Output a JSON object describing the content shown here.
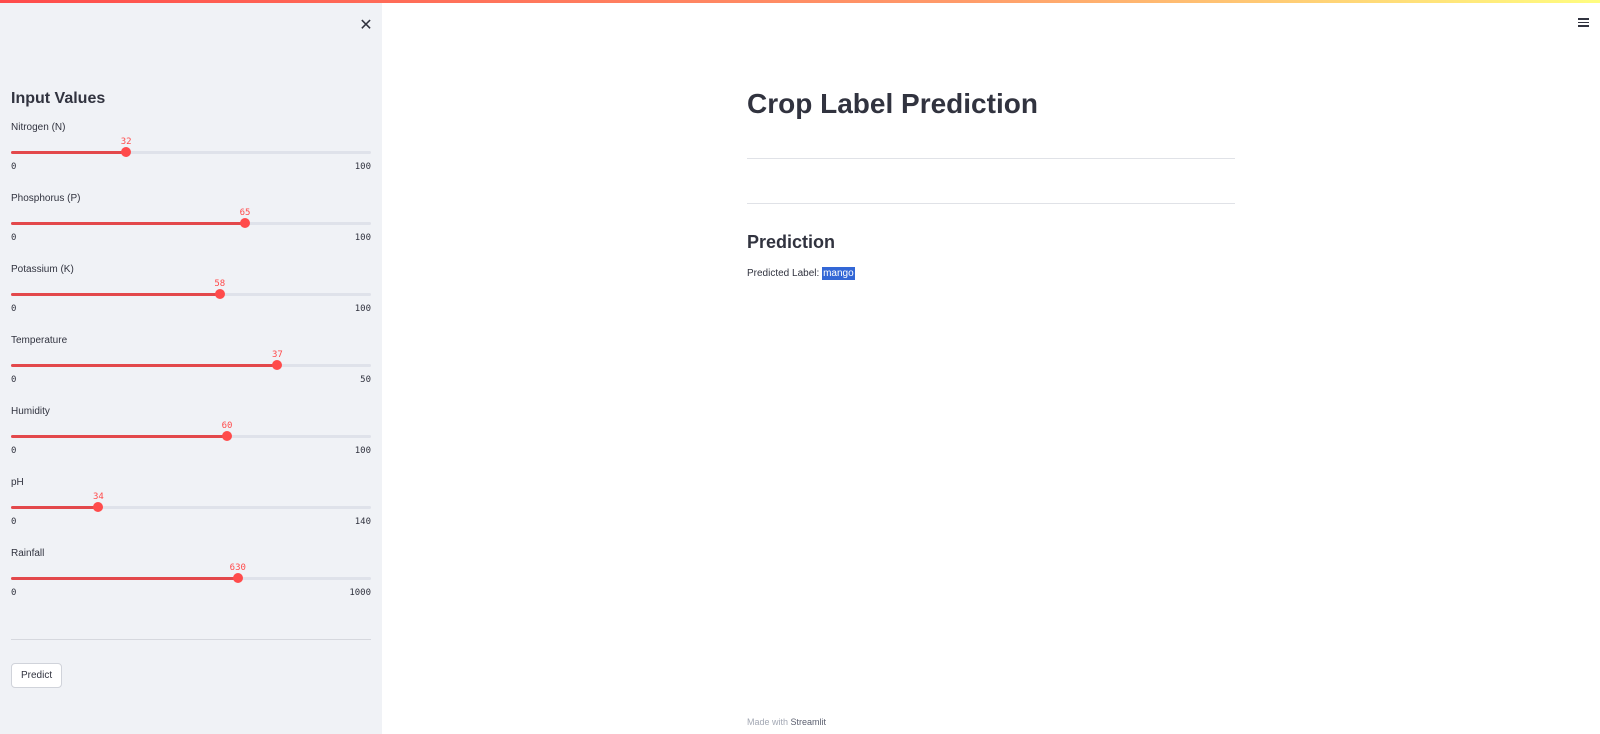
{
  "sidebar": {
    "close_icon": "close-icon",
    "title": "Input Values",
    "sliders": [
      {
        "label": "Nitrogen (N)",
        "value": "32",
        "min": "0",
        "max": "100"
      },
      {
        "label": "Phosphorus (P)",
        "value": "65",
        "min": "0",
        "max": "100"
      },
      {
        "label": "Potassium (K)",
        "value": "58",
        "min": "0",
        "max": "100"
      },
      {
        "label": "Temperature",
        "value": "37",
        "min": "0",
        "max": "50"
      },
      {
        "label": "Humidity",
        "value": "60",
        "min": "0",
        "max": "100"
      },
      {
        "label": "pH",
        "value": "34",
        "min": "0",
        "max": "140"
      },
      {
        "label": "Rainfall",
        "value": "630",
        "min": "0",
        "max": "1000"
      }
    ],
    "predict_label": "Predict"
  },
  "header": {
    "menu_icon": "hamburger-menu-icon"
  },
  "main": {
    "title": "Crop Label Prediction",
    "prediction_heading": "Prediction",
    "predicted_label_text": "Predicted Label: ",
    "predicted_value": "mango"
  },
  "footer": {
    "made_with": "Made with ",
    "brand": "Streamlit"
  },
  "colors": {
    "accent": "#ff4b4b",
    "sidebar_bg": "#f0f2f6",
    "text": "#31333f",
    "highlight": "#3367d6"
  }
}
